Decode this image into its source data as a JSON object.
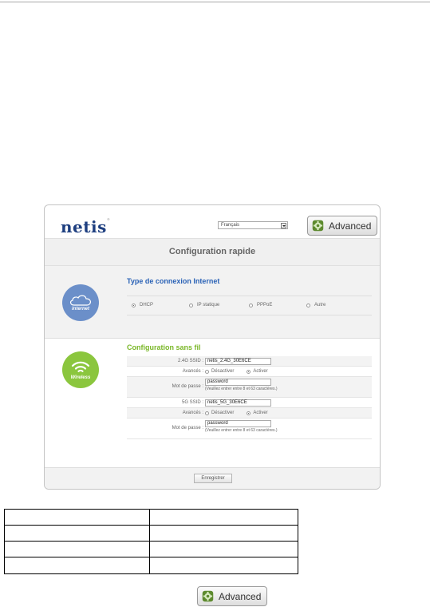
{
  "logo": {
    "brand": "netis",
    "mark": "®"
  },
  "language": {
    "selected": "Français"
  },
  "advanced_button": {
    "label": "Advanced"
  },
  "page_title": "Configuration rapide",
  "internet_section": {
    "icon_caption": "internet",
    "title": "Type de connexion Internet",
    "options": [
      {
        "label": "DHCP",
        "selected": true
      },
      {
        "label": "IP statique",
        "selected": false
      },
      {
        "label": "PPPoE",
        "selected": false
      },
      {
        "label": "Autre",
        "selected": false
      }
    ]
  },
  "wireless_section": {
    "icon_caption": "Wireless",
    "title": "Configuration sans fil",
    "band_24": {
      "ssid_label": "2.4G SSID :",
      "ssid_value": "netis_2.4G_30E6CE",
      "advanced_label": "Avancés :",
      "disable_label": "Désactiver",
      "enable_label": "Activer",
      "password_label": "Mot de passe :",
      "password_value": "password",
      "password_hint": "(Veuillez entrer entre 8 et 63 caractères.)"
    },
    "band_5": {
      "ssid_label": "5G SSID :",
      "ssid_value": "netis_5G_30E6CE",
      "advanced_label": "Avancés :",
      "disable_label": "Désactiver",
      "enable_label": "Activer",
      "password_label": "Mot de passe :",
      "password_value": "password",
      "password_hint": "(Veuillez entrer entre 8 et 63 caractères.)"
    }
  },
  "save_button": {
    "label": "Enregistrer"
  },
  "standalone_button": {
    "label": "Advanced"
  },
  "colors": {
    "logo": "#1e3f80",
    "internet_accent": "#2a62b6",
    "internet_icon": "#6b8fc9",
    "wireless_accent": "#7ab728",
    "wireless_icon": "#8bc63e",
    "gear": "#7cb342"
  }
}
